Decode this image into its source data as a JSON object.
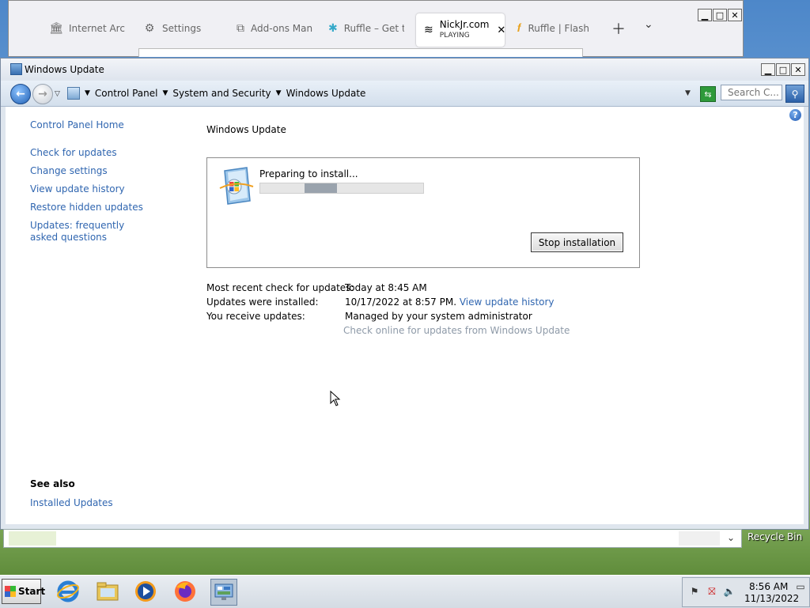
{
  "browser": {
    "tabs": [
      {
        "label": "Internet Arch",
        "icon": "archive-icon"
      },
      {
        "label": "Settings",
        "icon": "gear-icon"
      },
      {
        "label": "Add-ons Man",
        "icon": "puzzle-icon"
      },
      {
        "label": "Ruffle – Get t",
        "icon": "ruffle-icon"
      },
      {
        "label": "NickJr.com",
        "sublabel": "PLAYING",
        "icon": "nickjr-icon",
        "active": true
      },
      {
        "label": "Ruffle | Flash",
        "icon": "ruffle-flash-icon"
      }
    ]
  },
  "window": {
    "title": "Windows Update",
    "breadcrumb": [
      "Control Panel",
      "System and Security",
      "Windows Update"
    ],
    "search_placeholder": "Search C..."
  },
  "sidebar": {
    "home": "Control Panel Home",
    "links": [
      "Check for updates",
      "Change settings",
      "View update history",
      "Restore hidden updates",
      "Updates: frequently asked questions"
    ],
    "see_also_heading": "See also",
    "see_also_links": [
      "Installed Updates"
    ]
  },
  "main": {
    "heading": "Windows Update",
    "status": "Preparing to install...",
    "progress": 0.2,
    "stop_button": "Stop installation",
    "info": [
      {
        "label": "Most recent check for updates:",
        "value": "Today at 8:45 AM"
      },
      {
        "label": "Updates were installed:",
        "value": "10/17/2022 at 8:57 PM.",
        "link": "View update history"
      },
      {
        "label": "You receive updates:",
        "value": "Managed by your system administrator"
      }
    ],
    "check_online": "Check online for updates from Windows Update"
  },
  "desktop": {
    "recycle_bin": "Recycle Bin"
  },
  "taskbar": {
    "start": "Start",
    "time": "8:56 AM",
    "date": "11/13/2022"
  },
  "colors": {
    "link": "#3066b0",
    "disabled_link": "#8e9aa8"
  }
}
